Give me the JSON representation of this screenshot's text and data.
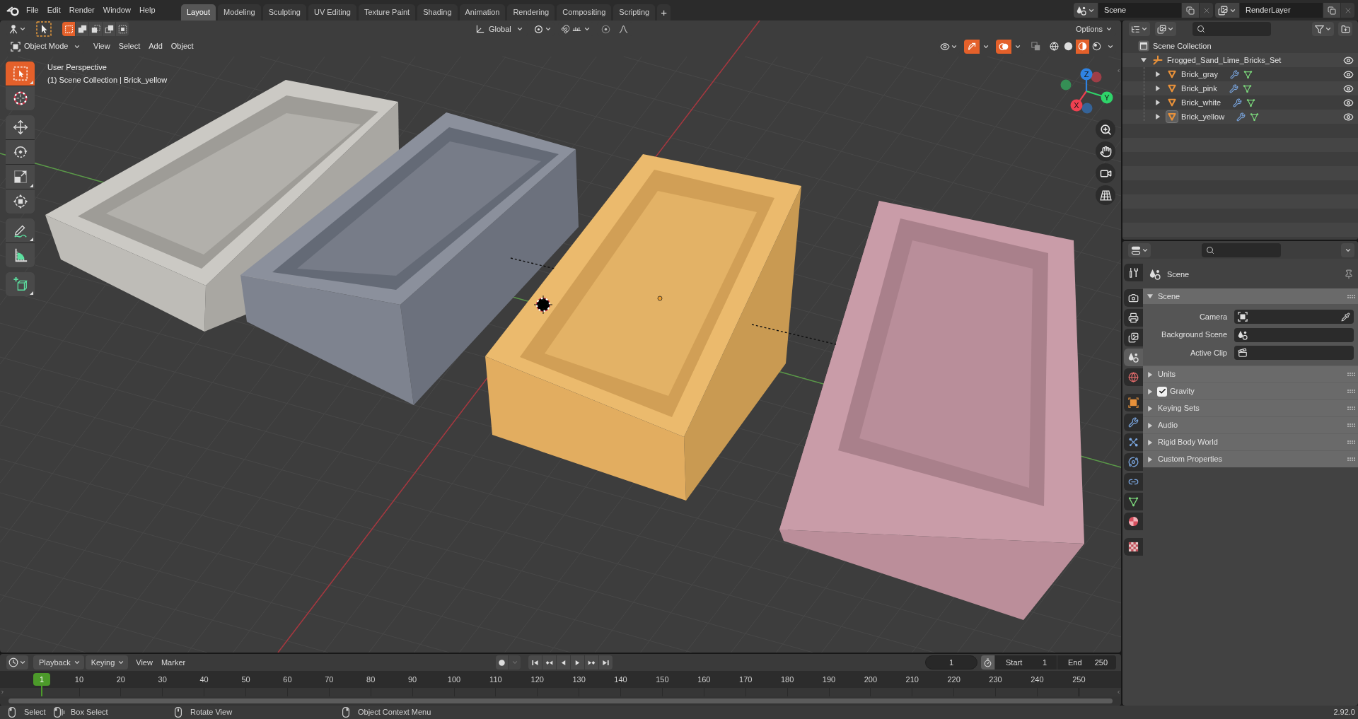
{
  "top_bar": {
    "menus": [
      "File",
      "Edit",
      "Render",
      "Window",
      "Help"
    ],
    "workspace_tabs": [
      {
        "label": "Layout",
        "selected": true
      },
      {
        "label": "Modeling",
        "selected": false
      },
      {
        "label": "Sculpting",
        "selected": false
      },
      {
        "label": "UV Editing",
        "selected": false
      },
      {
        "label": "Texture Paint",
        "selected": false
      },
      {
        "label": "Shading",
        "selected": false
      },
      {
        "label": "Animation",
        "selected": false
      },
      {
        "label": "Rendering",
        "selected": false
      },
      {
        "label": "Compositing",
        "selected": false
      },
      {
        "label": "Scripting",
        "selected": false
      }
    ],
    "add_workspace": "+",
    "scene": "Scene",
    "view_layer": "RenderLayer"
  },
  "viewport": {
    "tool_header": {
      "select_modes": [
        {
          "selected": true
        },
        {
          "selected": false
        },
        {
          "selected": false
        },
        {
          "selected": false
        },
        {
          "selected": false
        }
      ],
      "orientation": "Global",
      "options": "Options"
    },
    "header": {
      "mode": "Object Mode",
      "menus": [
        "View",
        "Select",
        "Add",
        "Object"
      ],
      "toggles": [
        {
          "kind": "gizmos",
          "on": true
        },
        {
          "kind": "overlays",
          "on": true
        },
        {
          "kind": "xray",
          "on": false
        }
      ],
      "shading_modes": [
        {
          "kind": "wireframe",
          "selected": false
        },
        {
          "kind": "solid",
          "selected": false
        },
        {
          "kind": "material",
          "selected": true
        },
        {
          "kind": "rendered",
          "selected": false
        }
      ]
    },
    "overlay_text": [
      "User Perspective",
      "(1) Scene Collection | Brick_yellow"
    ],
    "tools": [
      {
        "kind": "select_box",
        "selected": true
      },
      {
        "kind": "cursor",
        "selected": false
      },
      {
        "kind": "move",
        "selected": false
      },
      {
        "kind": "rotate",
        "selected": false
      },
      {
        "kind": "scale",
        "selected": false
      },
      {
        "kind": "transform",
        "selected": false
      },
      {
        "kind": "annotate",
        "selected": false
      },
      {
        "kind": "measure",
        "selected": false
      },
      {
        "kind": "add_cube",
        "selected": false
      }
    ],
    "gizmo_axes": [
      {
        "label": "X",
        "color": "#ee4050"
      },
      {
        "label": "Y",
        "color": "#2fd46a"
      },
      {
        "label": "Z",
        "color": "#2f83e3"
      }
    ]
  },
  "outliner": {
    "items": [
      {
        "label": "Scene Collection",
        "kind": "scene_collection",
        "children": [
          {
            "label": "Frogged_Sand_Lime_Bricks_Set",
            "kind": "empty",
            "expanded": true,
            "active": false,
            "visible": true,
            "children": [
              {
                "label": "Brick_gray",
                "kind": "mesh",
                "expanded": false,
                "active": false,
                "visible": true
              },
              {
                "label": "Brick_pink",
                "kind": "mesh",
                "expanded": false,
                "active": false,
                "visible": true
              },
              {
                "label": "Brick_white",
                "kind": "mesh",
                "expanded": false,
                "active": false,
                "visible": true
              },
              {
                "label": "Brick_yellow",
                "kind": "mesh",
                "expanded": false,
                "active": true,
                "visible": true
              }
            ]
          }
        ]
      }
    ]
  },
  "properties": {
    "tabs": [
      {
        "kind": "tool",
        "selected": false
      },
      {
        "kind": "render",
        "selected": false
      },
      {
        "kind": "output",
        "selected": false
      },
      {
        "kind": "view_layer",
        "selected": false
      },
      {
        "kind": "scene",
        "selected": true
      },
      {
        "kind": "world",
        "selected": false
      },
      {
        "kind": "object",
        "selected": false
      },
      {
        "kind": "modifiers",
        "selected": false
      },
      {
        "kind": "particles",
        "selected": false
      },
      {
        "kind": "physics",
        "selected": false
      },
      {
        "kind": "constraints",
        "selected": false
      },
      {
        "kind": "data",
        "selected": false
      },
      {
        "kind": "material",
        "selected": false
      },
      {
        "kind": "texture",
        "selected": false
      }
    ],
    "context": "Scene",
    "panels": [
      {
        "title": "Scene",
        "kind": "plain",
        "expanded": true,
        "fields": [
          {
            "label": "Camera",
            "kind": "object"
          },
          {
            "label": "Background Scene",
            "kind": "scene"
          },
          {
            "label": "Active Clip",
            "kind": "clip"
          }
        ]
      },
      {
        "title": "Units",
        "kind": "plain",
        "expanded": false
      },
      {
        "title": "Gravity",
        "kind": "checkbox",
        "checked": true,
        "expanded": false
      },
      {
        "title": "Keying Sets",
        "kind": "plain",
        "expanded": false
      },
      {
        "title": "Audio",
        "kind": "plain",
        "expanded": false
      },
      {
        "title": "Rigid Body World",
        "kind": "plain",
        "expanded": false
      },
      {
        "title": "Custom Properties",
        "kind": "plain",
        "expanded": false
      }
    ]
  },
  "timeline": {
    "dropdowns": [
      "Playback",
      "Keying"
    ],
    "menus": [
      "View",
      "Marker"
    ],
    "current_frame": "1",
    "start": {
      "label": "Start",
      "value": "1"
    },
    "end": {
      "label": "End",
      "value": "250"
    },
    "playhead": "1",
    "frame_labels": [
      "10",
      "20",
      "30",
      "40",
      "50",
      "60",
      "70",
      "80",
      "90",
      "100",
      "110",
      "120",
      "130",
      "140",
      "150",
      "160",
      "170",
      "180",
      "190",
      "200",
      "210",
      "220",
      "230",
      "240",
      "250"
    ]
  },
  "status_bar": {
    "hints": [
      {
        "kind": "left_click",
        "label": "Select"
      },
      {
        "kind": "left_drag",
        "label": "Box Select"
      },
      {
        "kind": "middle_drag",
        "label": "Rotate View"
      },
      {
        "kind": "right_click",
        "label": "Object Context Menu"
      }
    ],
    "version": "2.92.0"
  }
}
